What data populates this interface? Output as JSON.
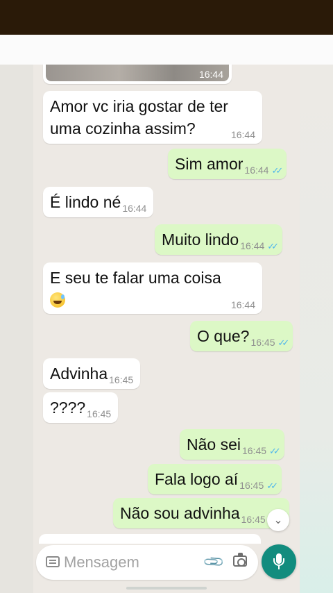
{
  "messages": [
    {
      "type": "image",
      "time": "16:44"
    },
    {
      "type": "in",
      "text": "Amor vc iria gostar de ter uma cozinha assim?",
      "time": "16:44"
    },
    {
      "type": "out",
      "text": "Sim amor",
      "time": "16:44",
      "status": "read"
    },
    {
      "type": "in",
      "text": "É lindo né",
      "time": "16:44"
    },
    {
      "type": "out",
      "text": "Muito lindo",
      "time": "16:44",
      "status": "read"
    },
    {
      "type": "in",
      "text": "E seu te falar uma coisa",
      "emoji": "grinning-sweat-emoji",
      "time": "16:44"
    },
    {
      "type": "out",
      "text": "O que?",
      "time": "16:45",
      "status": "read"
    },
    {
      "type": "in",
      "text": "Advinha",
      "time": "16:45"
    },
    {
      "type": "in",
      "text": "????",
      "time": "16:45"
    },
    {
      "type": "out",
      "text": "Não sei",
      "time": "16:45",
      "status": "read"
    },
    {
      "type": "out",
      "text": "Fala logo aí",
      "time": "16:45",
      "status": "read"
    },
    {
      "type": "out",
      "text": "Não sou advinha",
      "time": "16:45",
      "status": "read"
    }
  ],
  "read_ticks": "✓✓",
  "scroll_down_glyph": "⌄",
  "composer": {
    "placeholder": "Mensagem",
    "icons": [
      "keyboard-icon",
      "attach-icon",
      "camera-icon",
      "mic-icon"
    ]
  },
  "colors": {
    "incoming_bubble": "#ffffff",
    "outgoing_bubble": "#dcf8c6",
    "read_ticks": "#4fb6ec",
    "mic_button": "#128c7e",
    "status_bar": "#2a1a08"
  }
}
